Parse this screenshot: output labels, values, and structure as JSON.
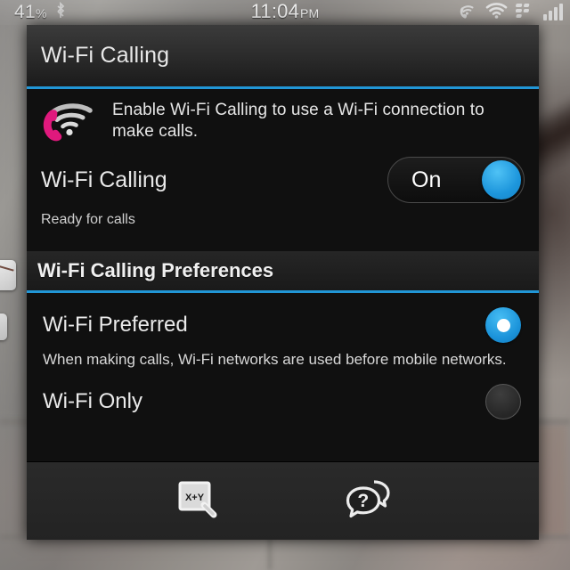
{
  "statusbar": {
    "battery_percent": "41",
    "percent_symbol": "%",
    "bluetooth_icon": "bluetooth-icon",
    "time": "11:04",
    "ampm": "PM",
    "wifi_calling_icon": "wifi-calling-status-icon",
    "wifi_icon": "wifi-icon",
    "blackberry_icon": "blackberry-logo-icon",
    "signal_icon": "signal-bars-icon",
    "signal_bars": 4
  },
  "app": {
    "title": "Wi-Fi Calling",
    "accent_color": "#2196d6",
    "background_color": "#101010"
  },
  "info": {
    "icon": "wifi-calling-icon",
    "text": "Enable Wi-Fi Calling to use a Wi-Fi connection to make calls.",
    "icon_color": "#e0197d"
  },
  "main_toggle": {
    "label": "Wi-Fi Calling",
    "state": "On",
    "status": "Ready for calls",
    "knob_color": "#1d96dc"
  },
  "preferences": {
    "header": "Wi-Fi Calling Preferences",
    "options": [
      {
        "label": "Wi-Fi Preferred",
        "selected": true,
        "description": "When making calls, Wi-Fi networks are used before mobile networks."
      },
      {
        "label": "Wi-Fi Only",
        "selected": false,
        "description": ""
      }
    ]
  },
  "toolbar": {
    "buttons": [
      {
        "icon": "xy-select-icon",
        "label": "X+Y"
      },
      {
        "icon": "help-chat-icon",
        "label": "?"
      }
    ]
  }
}
